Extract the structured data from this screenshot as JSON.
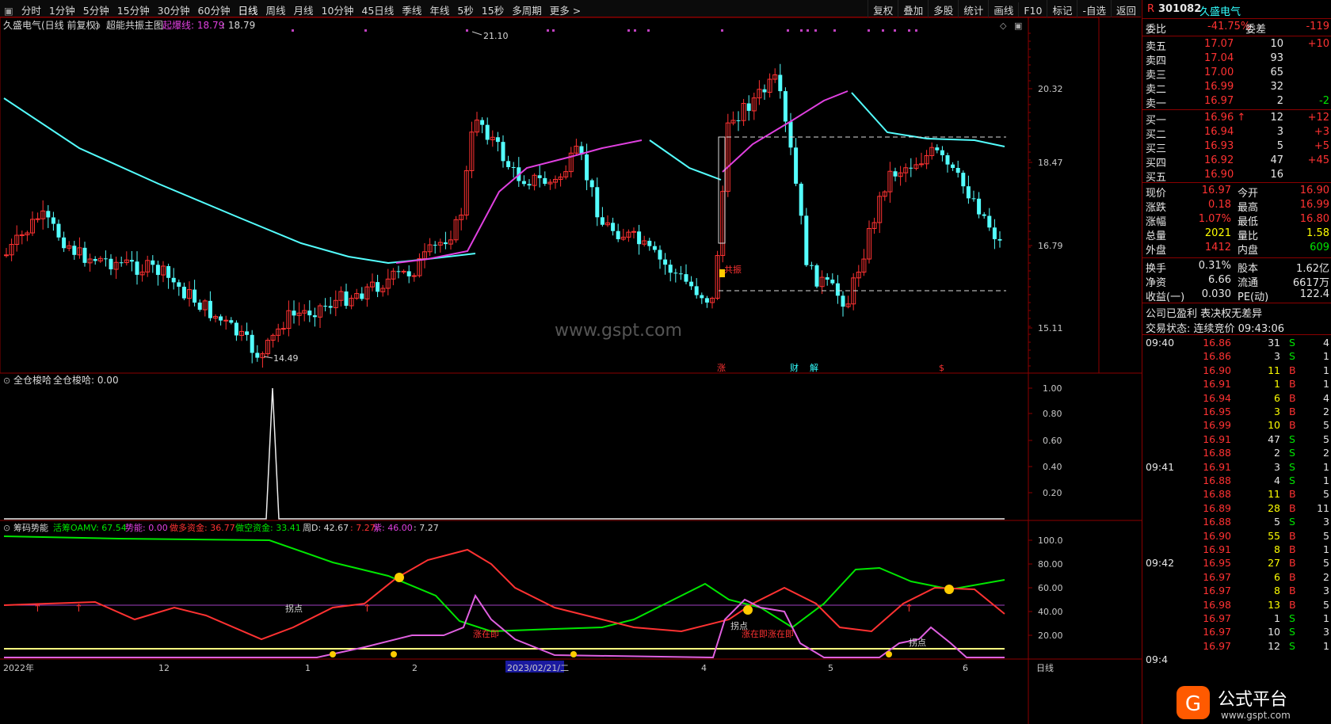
{
  "toolbar": {
    "periods": [
      "分时",
      "1分钟",
      "5分钟",
      "15分钟",
      "30分钟",
      "60分钟",
      "日线",
      "周线",
      "月线",
      "10分钟",
      "45日线",
      "季线",
      "年线",
      "5秒",
      "15秒",
      "多周期",
      "更多 >"
    ],
    "right_buttons": [
      "复权",
      "叠加",
      "多股",
      "统计",
      "画线",
      "F10",
      "标记",
      "-自选",
      "返回"
    ]
  },
  "main_title": {
    "stock": "久盛电气(日线 前复权)",
    "indicator": "超能共振主图",
    "line_label": "起爆线: 18.79",
    "line_value": ": 18.79"
  },
  "price_axis": [
    "20.32",
    "18.47",
    "16.79",
    "15.11"
  ],
  "annotations": {
    "high": "21.10",
    "low": "14.49",
    "gong_zhen": "共振",
    "watermark": "www.gspt.com",
    "markers": [
      "涨",
      "财",
      "解",
      "$"
    ]
  },
  "sub1": {
    "title": "全仓梭哈",
    "value_label": "全仓梭哈: 0.00",
    "axis": [
      "1.00",
      "0.80",
      "0.60",
      "0.40",
      "0.20"
    ]
  },
  "sub2": {
    "title": "筹码势能",
    "huochou": "活筹OAMV: 67.54",
    "shineng": "势能: 0.00",
    "zuoduo": "做多资金: 36.77",
    "zuokong": "做空资金: 33.41",
    "zhouD": "周D: 42.67",
    "v1": ": 7.27",
    "zi": "紫: 46.00",
    "v2": ": 7.27",
    "axis": [
      "100.0",
      "80.00",
      "60.00",
      "40.00",
      "20.00"
    ],
    "labels": [
      "拐点",
      "涨在即",
      "拐点",
      "涨在即涨在即",
      "拐点"
    ]
  },
  "date_axis": {
    "labels": [
      "2022年",
      "12",
      "1",
      "2",
      "2023/02/21/二",
      "4",
      "5",
      "6"
    ],
    "period": "日线"
  },
  "colors": {
    "red": "#ff3232",
    "green": "#00e600",
    "cyan": "#54ffff",
    "magenta": "#e040e0",
    "bg": "#000000",
    "border": "#8b0000"
  },
  "quote": {
    "code": "301082",
    "name": "久盛电气",
    "weibi_label": "委比",
    "weibi": "-41.75%",
    "weicha_label": "委差",
    "weicha": "-119",
    "asks": [
      {
        "label": "卖五",
        "price": "17.07",
        "vol": "10",
        "chg": "+10"
      },
      {
        "label": "卖四",
        "price": "17.04",
        "vol": "93",
        "chg": ""
      },
      {
        "label": "卖三",
        "price": "17.00",
        "vol": "65",
        "chg": ""
      },
      {
        "label": "卖二",
        "price": "16.99",
        "vol": "32",
        "chg": ""
      },
      {
        "label": "卖一",
        "price": "16.97",
        "vol": "2",
        "chg": "-2"
      }
    ],
    "bids": [
      {
        "label": "买一",
        "price": "16.96",
        "vol": "12",
        "chg": "+12"
      },
      {
        "label": "买二",
        "price": "16.94",
        "vol": "3",
        "chg": "+3"
      },
      {
        "label": "买三",
        "price": "16.93",
        "vol": "5",
        "chg": "+5"
      },
      {
        "label": "买四",
        "price": "16.92",
        "vol": "47",
        "chg": "+45"
      },
      {
        "label": "买五",
        "price": "16.90",
        "vol": "16",
        "chg": ""
      }
    ],
    "stats": [
      [
        "现价",
        "16.97",
        "今开",
        "16.90"
      ],
      [
        "涨跌",
        "0.18",
        "最高",
        "16.99"
      ],
      [
        "涨幅",
        "1.07%",
        "最低",
        "16.80"
      ],
      [
        "总量",
        "2021",
        "量比",
        "1.58"
      ],
      [
        "外盘",
        "1412",
        "内盘",
        "609"
      ]
    ],
    "stats2": [
      [
        "换手",
        "0.31%",
        "股本",
        "1.62亿"
      ],
      [
        "净资",
        "6.66",
        "流通",
        "6617万"
      ],
      [
        "收益(一)",
        "0.030",
        "PE(动)",
        "122.4"
      ]
    ],
    "profit": "公司已盈利 表决权无差异",
    "state": "交易状态: 连续竞价 09:43:06"
  },
  "ticks": [
    [
      "09:40",
      "16.86",
      "31",
      "S",
      "4"
    ],
    [
      "",
      "16.86",
      "3",
      "S",
      "1"
    ],
    [
      "",
      "16.90",
      "11",
      "B",
      "1"
    ],
    [
      "",
      "16.91",
      "1",
      "B",
      "1"
    ],
    [
      "",
      "16.94",
      "6",
      "B",
      "4"
    ],
    [
      "",
      "16.95",
      "3",
      "B",
      "2"
    ],
    [
      "",
      "16.99",
      "10",
      "B",
      "5"
    ],
    [
      "",
      "16.91",
      "47",
      "S",
      "5"
    ],
    [
      "",
      "16.88",
      "2",
      "S",
      "2"
    ],
    [
      "09:41",
      "16.91",
      "3",
      "S",
      "1"
    ],
    [
      "",
      "16.88",
      "4",
      "S",
      "1"
    ],
    [
      "",
      "16.88",
      "11",
      "B",
      "5"
    ],
    [
      "",
      "16.89",
      "28",
      "B",
      "11"
    ],
    [
      "",
      "16.88",
      "5",
      "S",
      "3"
    ],
    [
      "",
      "16.90",
      "55",
      "B",
      "5"
    ],
    [
      "",
      "16.91",
      "8",
      "B",
      "1"
    ],
    [
      "09:42",
      "16.95",
      "27",
      "B",
      "5"
    ],
    [
      "",
      "16.97",
      "6",
      "B",
      "2"
    ],
    [
      "",
      "16.97",
      "8",
      "B",
      "3"
    ],
    [
      "",
      "16.98",
      "13",
      "B",
      "5"
    ],
    [
      "",
      "16.97",
      "1",
      "S",
      "1"
    ],
    [
      "",
      "16.97",
      "10",
      "S",
      "3"
    ],
    [
      "",
      "16.97",
      "12",
      "S",
      "1"
    ],
    [
      "09:4",
      "",
      "",
      "",
      ""
    ]
  ],
  "logo_text": "公式平台",
  "logo_url": "www.gspt.com"
}
